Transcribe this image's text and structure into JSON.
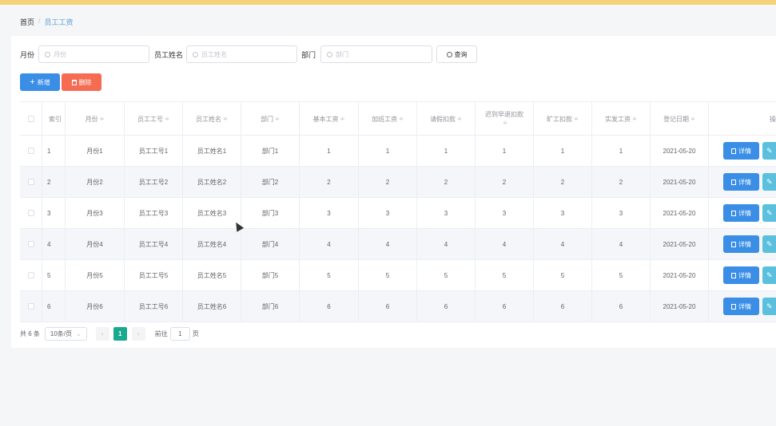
{
  "breadcrumb": {
    "home": "首页",
    "separator": "/",
    "current": "员工工资"
  },
  "search": {
    "month_label": "月份",
    "month_placeholder": "月份",
    "name_label": "员工姓名",
    "name_placeholder": "员工姓名",
    "dept_label": "部门",
    "dept_placeholder": "部门",
    "query_label": "查询"
  },
  "actions": {
    "add_label": "新增",
    "add_icon": "+",
    "delete_label": "删除"
  },
  "table": {
    "headers": {
      "index": "索引",
      "month": "月份",
      "emp_no": "员工工号",
      "emp_name": "员工姓名",
      "dept": "部门",
      "base": "基本工资",
      "overtime": "加班工资",
      "leave": "请假扣款",
      "late": "迟到早退扣款",
      "absent": "旷工扣款",
      "actual": "实发工资",
      "date": "登记日期",
      "op": "操"
    },
    "sort_icon": "≑",
    "rows": [
      {
        "index": "1",
        "month": "月份1",
        "emp_no": "员工工号1",
        "emp_name": "员工姓名1",
        "dept": "部门1",
        "base": "1",
        "overtime": "1",
        "leave": "1",
        "late": "1",
        "absent": "1",
        "actual": "1",
        "date": "2021-05-20"
      },
      {
        "index": "2",
        "month": "月份2",
        "emp_no": "员工工号2",
        "emp_name": "员工姓名2",
        "dept": "部门2",
        "base": "2",
        "overtime": "2",
        "leave": "2",
        "late": "2",
        "absent": "2",
        "actual": "2",
        "date": "2021-05-20"
      },
      {
        "index": "3",
        "month": "月份3",
        "emp_no": "员工工号3",
        "emp_name": "员工姓名3",
        "dept": "部门3",
        "base": "3",
        "overtime": "3",
        "leave": "3",
        "late": "3",
        "absent": "3",
        "actual": "3",
        "date": "2021-05-20"
      },
      {
        "index": "4",
        "month": "月份4",
        "emp_no": "员工工号4",
        "emp_name": "员工姓名4",
        "dept": "部门4",
        "base": "4",
        "overtime": "4",
        "leave": "4",
        "late": "4",
        "absent": "4",
        "actual": "4",
        "date": "2021-05-20"
      },
      {
        "index": "5",
        "month": "月份5",
        "emp_no": "员工工号5",
        "emp_name": "员工姓名5",
        "dept": "部门5",
        "base": "5",
        "overtime": "5",
        "leave": "5",
        "late": "5",
        "absent": "5",
        "actual": "5",
        "date": "2021-05-20"
      },
      {
        "index": "6",
        "month": "月份6",
        "emp_no": "员工工号6",
        "emp_name": "员工姓名6",
        "dept": "部门6",
        "base": "6",
        "overtime": "6",
        "leave": "6",
        "late": "6",
        "absent": "6",
        "actual": "6",
        "date": "2021-05-20"
      }
    ],
    "detail_label": "详情"
  },
  "pagination": {
    "total": "共 6 条",
    "page_size": "10条/页",
    "current_page": "1",
    "prev": "‹",
    "next": "›",
    "goto_label": "前往",
    "goto_value": "1",
    "page_suffix": "页"
  }
}
